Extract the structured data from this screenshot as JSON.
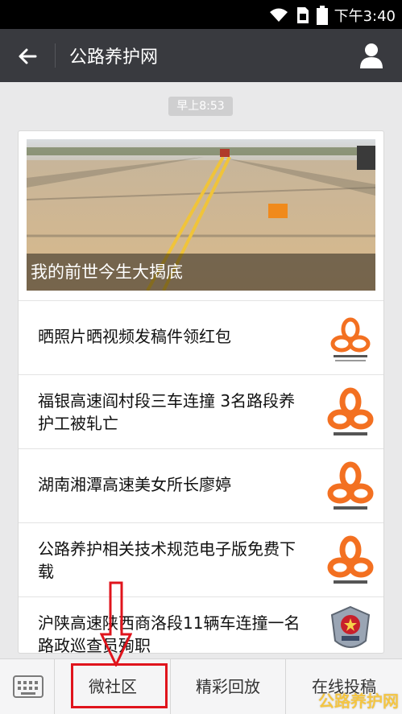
{
  "status_bar": {
    "time": "下午3:40"
  },
  "nav": {
    "title": "公路养护网"
  },
  "timestamp": "早上8:53",
  "hero": {
    "caption": "我的前世今生大揭底"
  },
  "articles": [
    {
      "title": "晒照片晒视频发稿件领红包",
      "thumb": "logo"
    },
    {
      "title": "福银高速阎村段三车连撞 3名路段养护工被轧亡",
      "thumb": "logo"
    },
    {
      "title": "湖南湘潭高速美女所长廖婷",
      "thumb": "logo"
    },
    {
      "title": "公路养护相关技术规范电子版免费下载",
      "thumb": "logo"
    },
    {
      "title": "沪陕高速陕西商洛段11辆车连撞一名路政巡查员殉职",
      "thumb": "police-emblem"
    }
  ],
  "bottom_menu": {
    "items": [
      "微社区",
      "精彩回放",
      "在线投稿"
    ]
  },
  "watermark": "公路养护网",
  "colors": {
    "accent": "#e0141c",
    "nav_bg": "#393a3f",
    "logo_orange": "#f37021"
  }
}
